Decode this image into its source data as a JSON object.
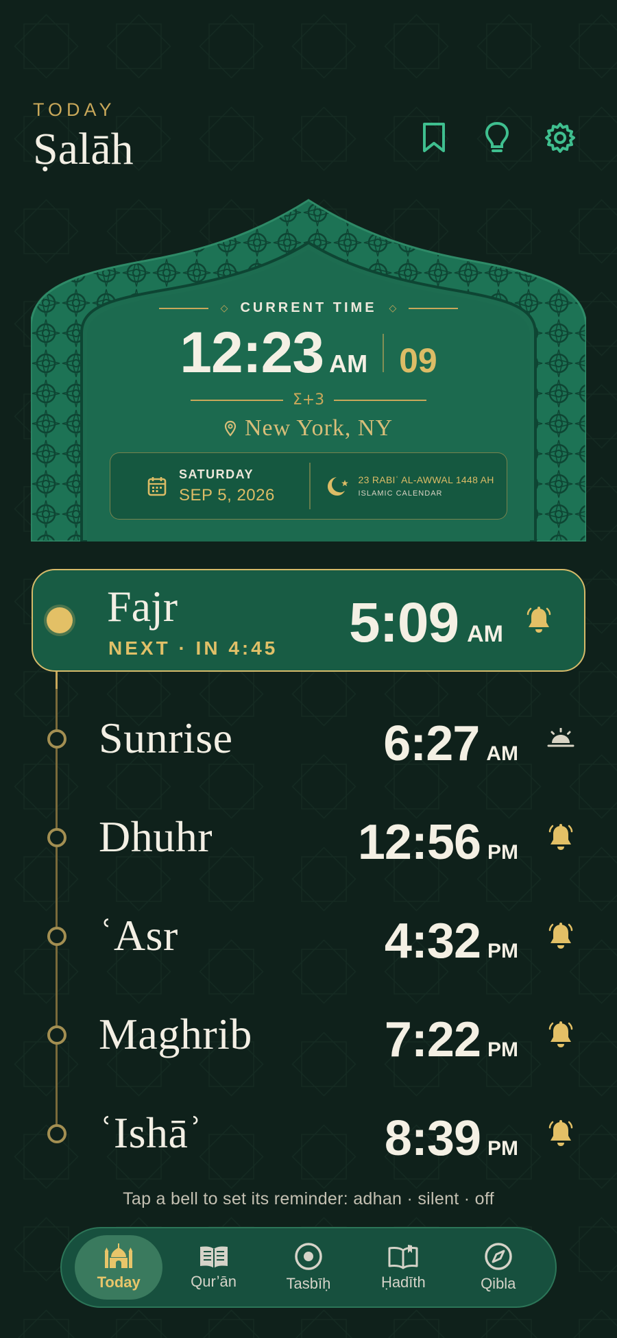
{
  "header": {
    "eyebrow": "TODAY",
    "title": "Ṣalāh",
    "icons": [
      "bookmark-icon",
      "lightbulb-icon",
      "gear-icon"
    ]
  },
  "clock": {
    "label": "CURRENT TIME",
    "time": "12:23",
    "ampm": "AM",
    "seconds": "09",
    "ornament": "Σ+3",
    "location": "New York, NY",
    "day_of_week": "SATURDAY",
    "gregorian_date": "SEP 5, 2026",
    "hijri_date": "23 RABIʿ AL-AWWAL 1448 AH",
    "hijri_label": "ISLAMIC CALENDAR"
  },
  "next_prayer": {
    "name": "Fajr",
    "subtitle": "NEXT · IN 4:45",
    "time": "5:09",
    "ampm": "AM",
    "icon": "bell-icon"
  },
  "prayers": [
    {
      "name": "Sunrise",
      "time": "6:27",
      "ampm": "AM",
      "icon": "sunrise-icon"
    },
    {
      "name": "Dhuhr",
      "time": "12:56",
      "ampm": "PM",
      "icon": "bell-icon"
    },
    {
      "name": "ʿAsr",
      "time": "4:32",
      "ampm": "PM",
      "icon": "bell-icon"
    },
    {
      "name": "Maghrib",
      "time": "7:22",
      "ampm": "PM",
      "icon": "bell-icon"
    },
    {
      "name": "ʿIshāʾ",
      "time": "8:39",
      "ampm": "PM",
      "icon": "bell-icon"
    }
  ],
  "hint": "Tap a bell to set its reminder: adhan · silent · off",
  "nav": [
    {
      "label": "Today",
      "icon": "mosque-icon",
      "active": true
    },
    {
      "label": "Qur’ān",
      "icon": "book-icon",
      "active": false
    },
    {
      "label": "Tasbīḥ",
      "icon": "target-icon",
      "active": false
    },
    {
      "label": "Ḥadīth",
      "icon": "open-book-icon",
      "active": false
    },
    {
      "label": "Qibla",
      "icon": "compass-icon",
      "active": false
    }
  ],
  "colors": {
    "background": "#0f211b",
    "card_green": "#185c44",
    "gold": "#dcbc66",
    "text": "#f4f0e4"
  }
}
